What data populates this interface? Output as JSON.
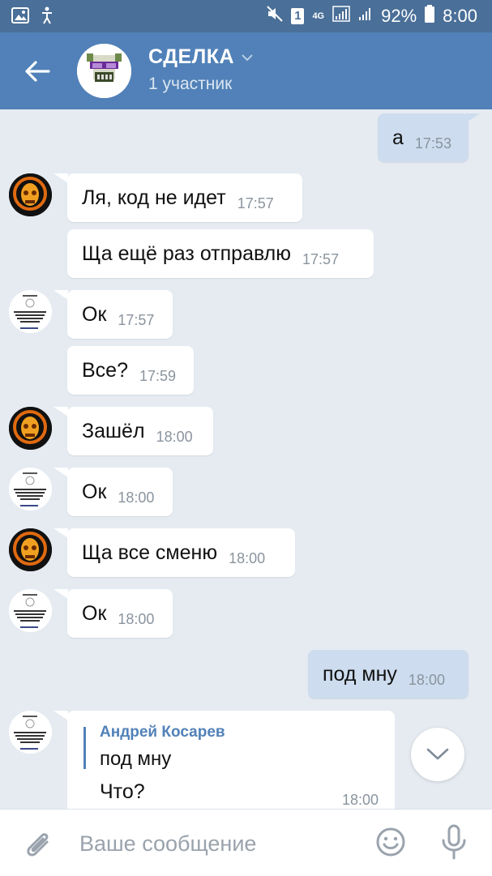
{
  "status_bar": {
    "sim_badge": "1",
    "network": "4G",
    "battery": "92%",
    "time": "8:00"
  },
  "header": {
    "title": "СДЕЛКА",
    "subtitle": "1 участник"
  },
  "messages": [
    {
      "text": "а",
      "time": "17:53"
    },
    {
      "text": "Ля, код не идет",
      "time": "17:57"
    },
    {
      "text": "Ща ещё раз отправлю",
      "time": "17:57"
    },
    {
      "text": "Ок",
      "time": "17:57"
    },
    {
      "text": "Все?",
      "time": "17:59"
    },
    {
      "text": "Зашёл",
      "time": "18:00"
    },
    {
      "text": "Ок",
      "time": "18:00"
    },
    {
      "text": "Ща все сменю",
      "time": "18:00"
    },
    {
      "text": "Ок",
      "time": "18:00"
    },
    {
      "text": "под мну",
      "time": "18:00"
    }
  ],
  "reply_message": {
    "quoted_author": "Андрей Косарев",
    "quoted_text": "под мну",
    "text": "Что?",
    "time": "18:00"
  },
  "composer": {
    "placeholder": "Ваше сообщение"
  }
}
